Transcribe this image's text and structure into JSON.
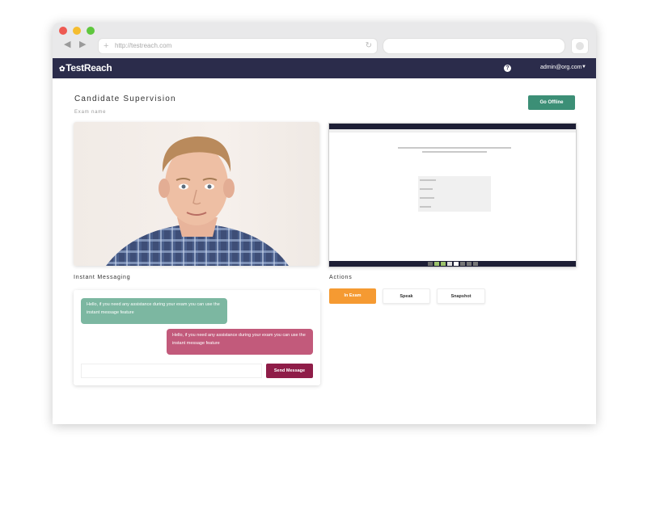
{
  "browser": {
    "url": "http://testreach.com",
    "nav_back": "◀",
    "nav_forward": "▶",
    "plus_glyph": "+",
    "reload_glyph": "↻"
  },
  "header": {
    "logo": "TestReach",
    "logo_glyph": "✿",
    "help_glyph": "?",
    "user_email": "admin@org.com",
    "caret_glyph": "▼"
  },
  "page": {
    "title": "Candidate Supervision",
    "subtitle": "Exam name",
    "go_offline_label": "Go Offline"
  },
  "chat": {
    "section_label": "Instant Messaging",
    "incoming_message": "Hello, if you need any assistance during your exam you can use the instant message feature",
    "outgoing_message": "Hello, if you need any assistance during your exam you can use the instant message feature",
    "input_value": "",
    "send_label": "Send Message"
  },
  "actions": {
    "section_label": "Actions",
    "buttons": [
      "In Exam",
      "Speak",
      "Snapshot"
    ]
  },
  "colors": {
    "header_bg": "#2b2c4b",
    "go_offline": "#3c8f76",
    "incoming_bubble": "#7cb7a1",
    "outgoing_bubble": "#c25a7b",
    "send_button": "#8f1d48",
    "in_exam": "#f59a32"
  }
}
